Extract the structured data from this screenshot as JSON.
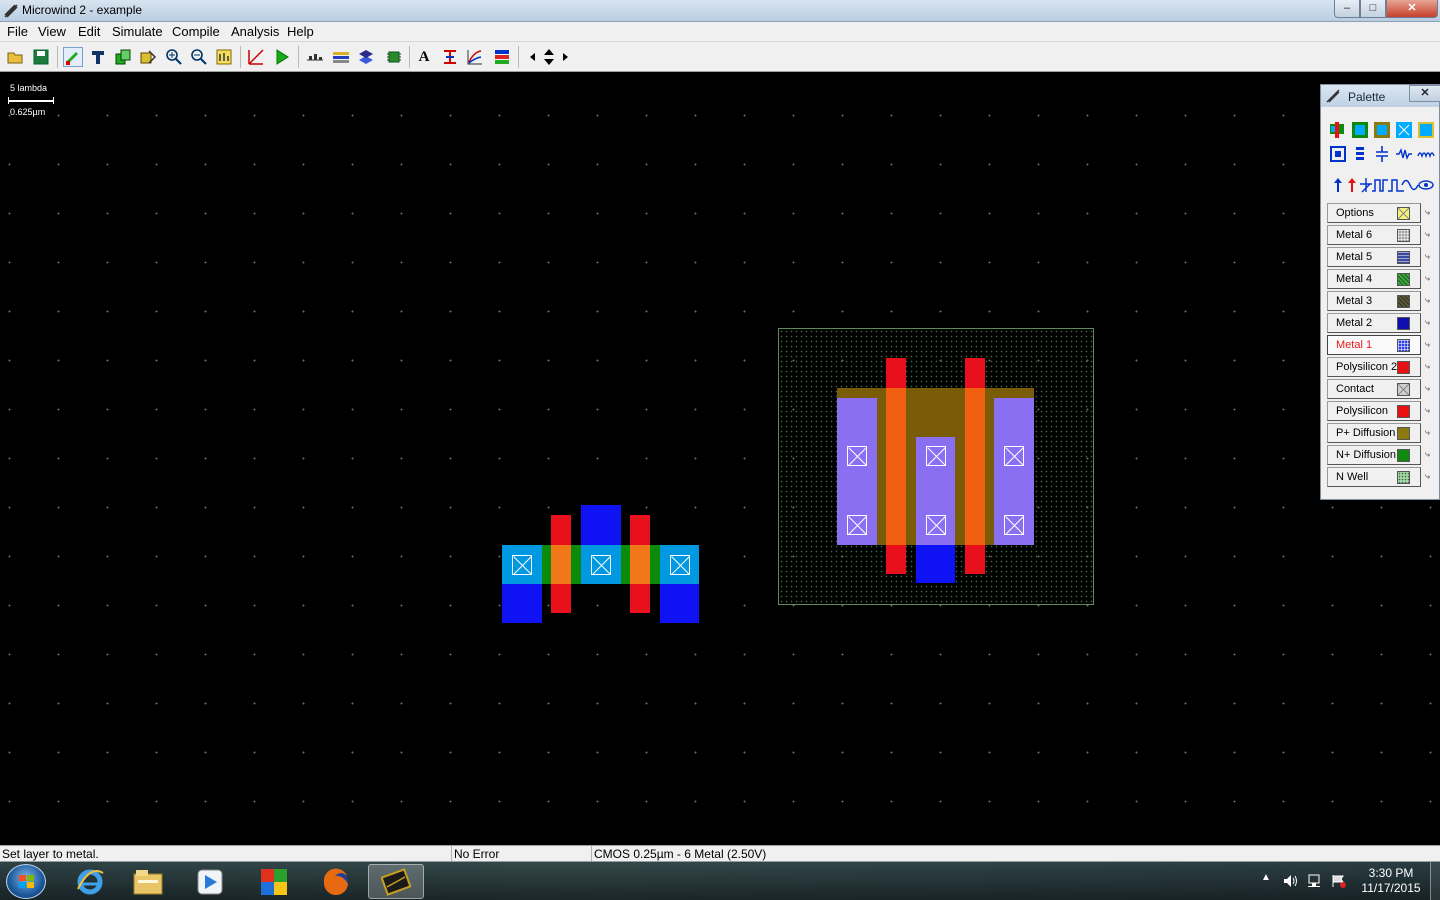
{
  "window": {
    "title": "Microwind 2 - example",
    "minimize": "–",
    "maximize": "□",
    "close": "✕"
  },
  "menu": [
    "File",
    "View",
    "Edit",
    "Simulate",
    "Compile",
    "Analysis",
    "Help"
  ],
  "toolbar": {
    "icons": [
      "open-icon",
      "save-icon",
      "draw-box-icon",
      "edit-icon",
      "duplicate-icon",
      "move-icon",
      "zoom-in-icon",
      "zoom-out-icon",
      "view-all-icon",
      "measure-icon",
      "run-simulation-icon",
      "process-section-icon",
      "cross-section-icon",
      "3d-view-icon",
      "chip-view-icon",
      "text-icon",
      "connect-icon",
      "electrical-icon",
      "layer-icon",
      "scroll-left-icon",
      "pan-icon",
      "scroll-right-icon"
    ],
    "text_glyph": "A"
  },
  "scale": {
    "top": "5 lambda",
    "bottom": "0.625µm"
  },
  "palette": {
    "title": "Palette",
    "close": "✕",
    "layers": [
      {
        "label": "Options",
        "color": "#f6f27a",
        "pattern": "cross",
        "active": false
      },
      {
        "label": "Metal 6",
        "color": "#a0a0a0",
        "pattern": "grid",
        "active": false
      },
      {
        "label": "Metal 5",
        "color": "#3a4aa0",
        "pattern": "lines",
        "active": false
      },
      {
        "label": "Metal 4",
        "color": "#3aa83a",
        "pattern": "hatch",
        "active": false
      },
      {
        "label": "Metal 3",
        "color": "#5a5a3a",
        "pattern": "hatch",
        "active": false
      },
      {
        "label": "Metal 2",
        "color": "#1010b0",
        "pattern": "solid",
        "active": false
      },
      {
        "label": "Metal 1",
        "color": "#2a40e8",
        "pattern": "grid",
        "active": true
      },
      {
        "label": "Polysilicon 2",
        "color": "#e81010",
        "pattern": "solid",
        "active": false
      },
      {
        "label": "Contact",
        "color": "#d0d0d0",
        "pattern": "cross",
        "active": false
      },
      {
        "label": "Polysilicon",
        "color": "#e81010",
        "pattern": "solid",
        "active": false
      },
      {
        "label": "P+ Diffusion",
        "color": "#8a7a10",
        "pattern": "solid",
        "active": false
      },
      {
        "label": "N+ Diffusion",
        "color": "#108a10",
        "pattern": "solid",
        "active": false
      },
      {
        "label": "N Well",
        "color": "#a8d8a8",
        "pattern": "dots",
        "active": false
      }
    ]
  },
  "status": {
    "message": "Set layer to metal.",
    "errors": "No Error",
    "technology": "CMOS 0.25µm - 6 Metal (2.50V)"
  },
  "taskbar": {
    "apps": [
      "internet-explorer-icon",
      "file-explorer-icon",
      "media-player-icon",
      "windows-flag-icon",
      "firefox-icon",
      "microwind-icon"
    ],
    "time": "3:30 PM",
    "date": "11/17/2015"
  },
  "colors": {
    "metal1": "#0f12f2",
    "n_diffusion": "#0c8a0c",
    "polysilicon": "#e8101a",
    "p_diffusion": "#7a5c08",
    "n_well_border": "#5e8a5e"
  }
}
